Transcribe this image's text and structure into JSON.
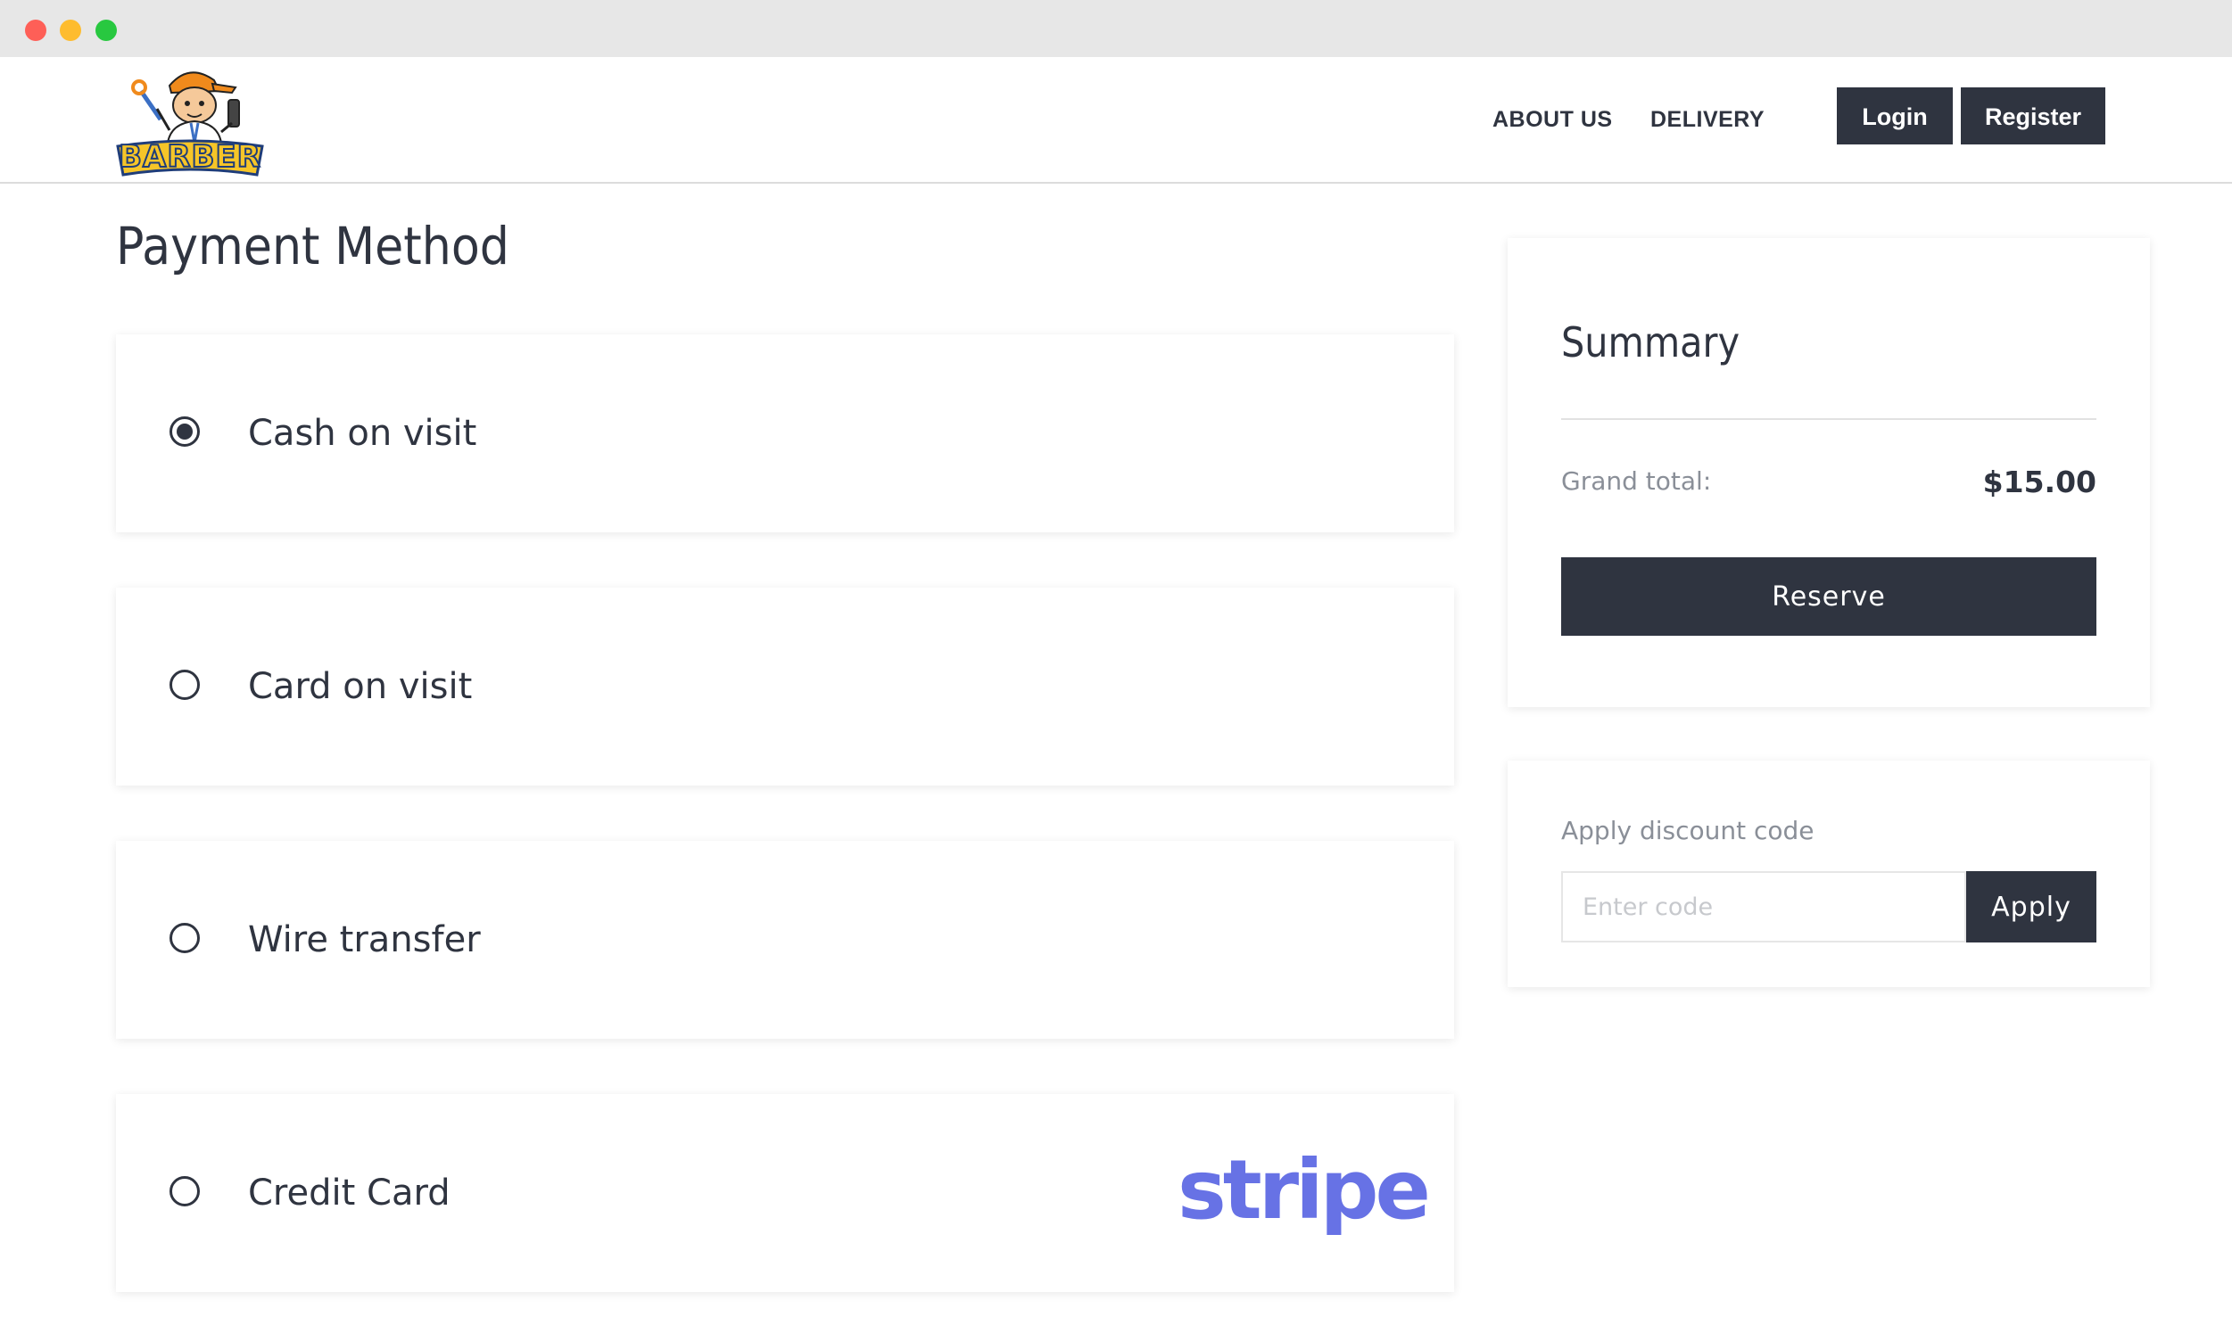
{
  "header": {
    "logo_text": "BARBER",
    "nav": {
      "about": "ABOUT US",
      "delivery": "DELIVERY"
    },
    "login_label": "Login",
    "register_label": "Register"
  },
  "payment": {
    "title": "Payment Method",
    "selected_index": 0,
    "options": [
      {
        "label": "Cash on visit",
        "selected": true
      },
      {
        "label": "Card on visit",
        "selected": false
      },
      {
        "label": "Wire transfer",
        "selected": false
      },
      {
        "label": "Credit Card",
        "selected": false,
        "brand": "stripe"
      }
    ]
  },
  "summary": {
    "title": "Summary",
    "grand_total_label": "Grand total:",
    "grand_total_value": "$15.00",
    "reserve_label": "Reserve"
  },
  "discount": {
    "label": "Apply discount code",
    "placeholder": "Enter code",
    "value": "",
    "apply_label": "Apply"
  },
  "colors": {
    "primary_dark": "#2f3440",
    "stripe_brand": "#6772e5",
    "muted_text": "#8a8f98"
  }
}
